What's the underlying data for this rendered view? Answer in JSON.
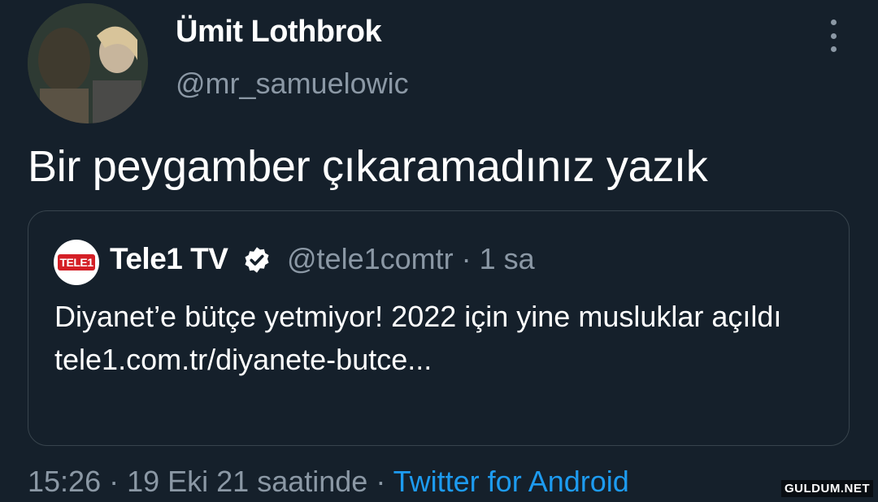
{
  "author": {
    "display_name": "Ümit Lothbrok",
    "handle": "@mr_samuelowic"
  },
  "tweet": {
    "text": "Bir peygamber çıkaramadınız yazık"
  },
  "quoted_tweet": {
    "display_name": "Tele1 TV",
    "handle": "@tele1comtr",
    "separator": " · ",
    "time": "1 sa",
    "logo_text": "TELE1",
    "text_line1": "Diyanet’e bütçe yetmiyor! 2022 için yine musluklar açıldı",
    "link": "tele1.com.tr/diyanete-butce..."
  },
  "meta": {
    "time": "15:26",
    "sep1": " · ",
    "date": "19 Eki 21 saatinde",
    "sep2": " · ",
    "source": "Twitter for Android"
  },
  "watermark": "GULDUM.NET",
  "icons": {
    "more": "more-vertical-icon",
    "verified": "verified-badge-icon"
  },
  "colors": {
    "background": "#15202b",
    "secondary_text": "#8b98a5",
    "link": "#1d9bf0",
    "border": "#38444d"
  }
}
